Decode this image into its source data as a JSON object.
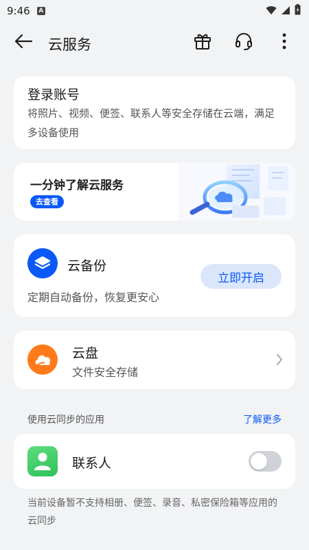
{
  "status_bar": {
    "time": "9:46",
    "notification_icon": "A",
    "icons": [
      "wifi-icon",
      "signal-icon",
      "battery-icon"
    ]
  },
  "header": {
    "title": "云服务",
    "icons": [
      "back-arrow-icon",
      "gift-icon",
      "headset-icon",
      "more-vert-icon"
    ]
  },
  "login": {
    "title": "登录账号",
    "description": "将照片、视频、便签、联系人等安全存储在云端，满足多设备使用"
  },
  "promo": {
    "title": "一分钟了解云服务",
    "button": "去查看",
    "art": "cloud-magnifier-illustration"
  },
  "backup": {
    "title": "云备份",
    "button": "立即开启",
    "description": "定期自动备份，恢复更安心",
    "icon": "layers-icon"
  },
  "drive": {
    "title": "云盘",
    "description": "文件安全存储",
    "icon": "cloud-icon"
  },
  "sync_section": {
    "header": "使用云同步的应用",
    "link": "了解更多",
    "apps": [
      {
        "name": "联系人",
        "icon": "contacts-icon",
        "enabled": false
      }
    ],
    "footer": "当前设备暂不支持相册、便签、录音、私密保险箱等应用的云同步"
  },
  "colors": {
    "accent": "#0a59f7",
    "background": "#f1f3f5",
    "drive_orange": "#ff7a1a",
    "contacts_green": "#2ec15a"
  }
}
